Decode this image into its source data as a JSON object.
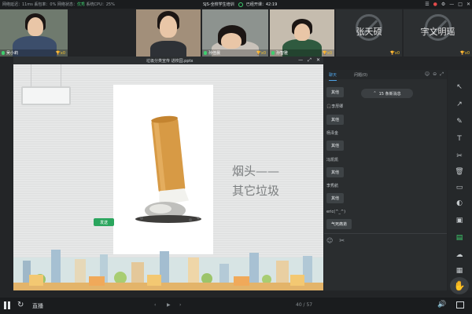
{
  "status_bar": {
    "stats_prefix": "网络延迟：11ms  丢包率：0%  网络状态：",
    "network_state": "优秀",
    "cpu": "  系统CPU：25%",
    "session": "SJS-全校学生培训",
    "elapsed_label": "已经开课：",
    "elapsed": "42:19"
  },
  "participants": [
    {
      "name": "吴小莉",
      "trophy": "x0"
    },
    {
      "name": "",
      "trophy": ""
    },
    {
      "name": "孙佳晨",
      "trophy": "x0"
    },
    {
      "name": "孙智雅",
      "trophy": "x0"
    },
    {
      "name": "张天硕",
      "trophy": "x0",
      "camera_off": true
    },
    {
      "name": "宇文明瑶",
      "trophy": "x0",
      "camera_off": true
    }
  ],
  "slide_window": {
    "title": "垃圾分类宣传 进校园.pptx",
    "caption_line1": "烟头——",
    "caption_line2": "其它垃圾"
  },
  "chat": {
    "tab_chat": "聊天",
    "tab_questions": "问题(0)",
    "new_messages": "15 条新消息",
    "messages": [
      {
        "sender": "",
        "text": "其他"
      },
      {
        "sender": "李厚卿",
        "text": "其他"
      },
      {
        "sender": "杨泽金",
        "text": "其他"
      },
      {
        "sender": "冯凯凯",
        "text": "其他"
      },
      {
        "sender": "李秀航",
        "text": "其他"
      },
      {
        "sender": "eric(^_^)",
        "text": "气死痛弟"
      }
    ],
    "send_label": "发送"
  },
  "bottom_bar": {
    "live_label": "直播",
    "page_current": "40",
    "page_total": "57"
  },
  "colors": {
    "accent_green": "#3ecf6e",
    "accent_blue": "#4fa3e6",
    "trophy": "#f2c230"
  }
}
